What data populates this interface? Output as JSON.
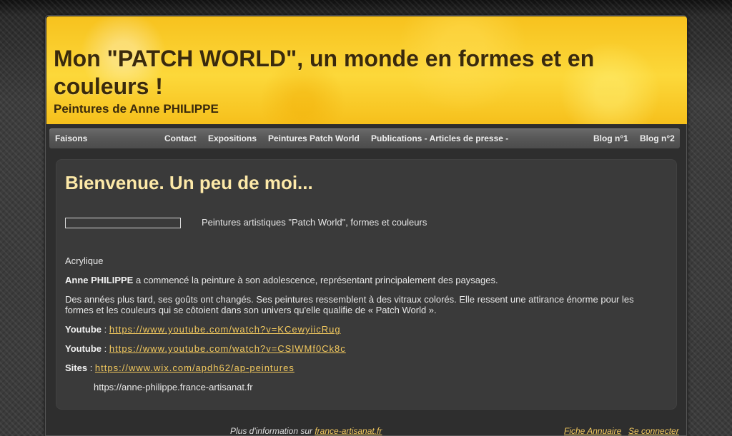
{
  "header": {
    "title": "Mon \"PATCH WORLD\", un monde en formes et en couleurs !",
    "subtitle": "Peintures de Anne PHILIPPE"
  },
  "nav": {
    "items": [
      {
        "label": "Faisons"
      },
      {
        "label": "Contact"
      },
      {
        "label": "Expositions"
      },
      {
        "label": "Peintures Patch World"
      },
      {
        "label": "Publications - Articles de presse -"
      },
      {
        "label": "Blog n°1"
      },
      {
        "label": "Blog n°2"
      }
    ]
  },
  "main": {
    "title": "Bienvenue. Un peu de moi...",
    "caption": "Peintures artistiques \"Patch World\", formes et couleurs",
    "medium": "Acrylique",
    "intro_name": "Anne PHILIPPE",
    "intro_text": " a commencé la peinture à son adolescence, représentant principalement des paysages.",
    "paragraph": "Des années plus tard, ses goûts ont changés.  Ses peintures ressemblent à des vitraux colorés.  Elle ressent une attirance énorme pour les formes et les couleurs qui se côtoient dans son univers qu'elle qualifie de « Patch World ».",
    "links": [
      {
        "label": "Youtube",
        "sep": " : ",
        "url": "https://www.youtube.com/watch?v=KCewyiicRug"
      },
      {
        "label": "Youtube",
        "sep": " : ",
        "url": "https://www.youtube.com/watch?v=CSlWMf0Ck8c"
      },
      {
        "label": "Sites",
        "sep": " : ",
        "url": "https://www.wix.com/apdh62/ap-peintures"
      }
    ],
    "extra_site": "https://anne-philippe.france-artisanat.fr"
  },
  "footer": {
    "info_text": "Plus d'information sur ",
    "info_link": "france-artisanat.fr",
    "directory_link": "Fiche Annuaire",
    "login_link": "Se connecter"
  },
  "colors": {
    "header_yellow": "#f7c21e",
    "title_brown": "#3a2a0c",
    "heading_cream": "#fde9a8",
    "link_gold": "#f3c95e",
    "nav_gray": "#575757"
  }
}
